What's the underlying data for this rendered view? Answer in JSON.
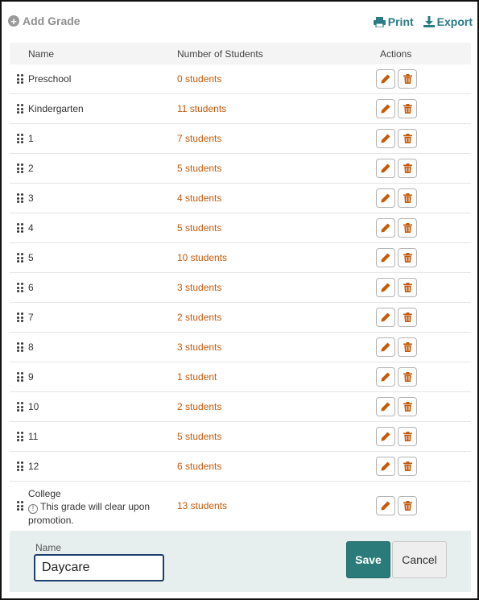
{
  "toolbar": {
    "add_grade": "Add Grade",
    "print": "Print",
    "export": "Export"
  },
  "table": {
    "headers": {
      "name": "Name",
      "count": "Number of Students",
      "actions": "Actions"
    },
    "rows": [
      {
        "name": "Preschool",
        "count": "0 students"
      },
      {
        "name": "Kindergarten",
        "count": "11 students"
      },
      {
        "name": "1",
        "count": "7 students"
      },
      {
        "name": "2",
        "count": "5 students"
      },
      {
        "name": "3",
        "count": "4 students"
      },
      {
        "name": "4",
        "count": "5 students"
      },
      {
        "name": "5",
        "count": "10 students"
      },
      {
        "name": "6",
        "count": "3 students"
      },
      {
        "name": "7",
        "count": "2 students"
      },
      {
        "name": "8",
        "count": "3 students"
      },
      {
        "name": "9",
        "count": "1 student"
      },
      {
        "name": "10",
        "count": "2 students"
      },
      {
        "name": "11",
        "count": "5 students"
      },
      {
        "name": "12",
        "count": "6 students"
      }
    ],
    "last_row": {
      "name": "College",
      "note": "This grade will clear upon promotion.",
      "count": "13 students"
    }
  },
  "edit_panel": {
    "label": "Name",
    "value": "Daycare",
    "save": "Save",
    "cancel": "Cancel"
  },
  "colors": {
    "accent": "#2a7b83",
    "count_link": "#c45a0a",
    "panel_bg": "#e6efee",
    "save_bg": "#2a7b7a"
  },
  "icons": {
    "add": "plus-circle-icon",
    "print": "printer-icon",
    "export": "download-icon",
    "drag": "drag-handle-icon",
    "edit": "pencil-icon",
    "delete": "trash-icon",
    "info": "info-icon"
  }
}
